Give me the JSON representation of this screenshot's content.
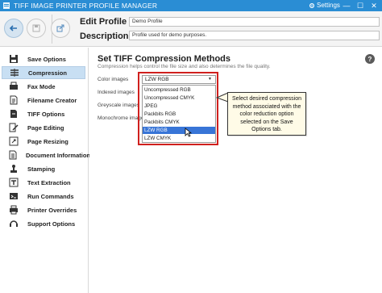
{
  "titlebar": {
    "title": "TIFF IMAGE PRINTER PROFILE MANAGER",
    "settings_label": "Settings",
    "minimize": "—",
    "maximize": "☐",
    "close": "✕",
    "bg_color": "#2a8dd4"
  },
  "header": {
    "edit_profile_label": "Edit Profile -",
    "profile_name": "Demo Profile",
    "description_label": "Description",
    "description_value": "Profile used for demo purposes."
  },
  "sidebar": {
    "items": [
      {
        "label": "Save Options",
        "icon": "save-icon"
      },
      {
        "label": "Compression",
        "icon": "compress-icon",
        "selected": true
      },
      {
        "label": "Fax Mode",
        "icon": "fax-icon"
      },
      {
        "label": "Filename Creator",
        "icon": "filename-icon"
      },
      {
        "label": "TIFF Options",
        "icon": "tiff-icon"
      },
      {
        "label": "Page Editing",
        "icon": "page-edit-icon"
      },
      {
        "label": "Page Resizing",
        "icon": "page-resize-icon"
      },
      {
        "label": "Document Information",
        "icon": "doc-info-icon"
      },
      {
        "label": "Stamping",
        "icon": "stamp-icon"
      },
      {
        "label": "Text Extraction",
        "icon": "text-extraction-icon"
      },
      {
        "label": "Run Commands",
        "icon": "run-commands-icon"
      },
      {
        "label": "Printer Overrides",
        "icon": "printer-icon"
      },
      {
        "label": "Support Options",
        "icon": "support-icon"
      }
    ]
  },
  "main": {
    "title": "Set TIFF Compression Methods",
    "subtitle": "Compression helps control the file size and also determines the file quality.",
    "help": "?",
    "labels": {
      "color": "Color images",
      "indexed": "Indexed images",
      "greyscale": "Greyscale images",
      "monochrome": "Monochrome images"
    },
    "combo_value": "LZW RGB",
    "options": [
      "Uncompressed RGB",
      "Uncompressed CMYK",
      "JPEG",
      "Packbits RGB",
      "Packbits CMYK",
      "LZW RGB",
      "LZW CMYK"
    ],
    "highlighted_option": "LZW RGB",
    "tooltip": "Select desired compression method associated with the color reduction option selected on the Save Options tab."
  },
  "colors": {
    "accent": "#2a8dd4",
    "selected_nav": "#c8dff3",
    "highlight": "#3875d7",
    "callout_frame": "#d0201e",
    "tooltip_bg": "#fffbe7"
  }
}
